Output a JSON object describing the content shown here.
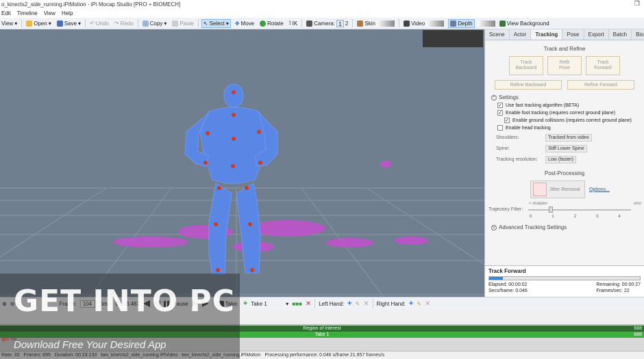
{
  "window": {
    "title": "o_kinects2_side_running.iPiMotion - iPi Mocap Studio [PRO + BIOMECH]",
    "restore_glyph": "❐"
  },
  "menu": [
    "Edit",
    "Timeline",
    "View",
    "Help"
  ],
  "toolbar": {
    "view": "View",
    "open": "Open",
    "save": "Save",
    "undo": "Undo",
    "redo": "Redo",
    "copy": "Copy",
    "paste": "Paste",
    "select": "Select",
    "move": "Move",
    "rotate": "Rotate",
    "ik": "IK",
    "camera": "Camera:",
    "cam1": "1",
    "cam2": "2",
    "skin": "Skin",
    "video": "Video",
    "depth": "Depth",
    "view_background": "View Background"
  },
  "panel": {
    "tabs": [
      "Scene",
      "Actor",
      "Tracking",
      "Pose",
      "Export",
      "Batch",
      "Biomech"
    ],
    "active_tab": "Tracking",
    "track_refine_title": "Track and Refine",
    "track_backward": "Track\nBackward",
    "refit_pose": "Refit\nPose",
    "track_forward": "Track\nForward",
    "refine_backward": "Refine Backward",
    "refine_forward": "Refine Forward",
    "settings_title": "Settings",
    "chk_fast": "Use fast tracking algorithm (BETA)",
    "chk_foot": "Enable foot tracking (requires correct ground plane)",
    "chk_ground": "Enable ground collisions (requires correct ground plane)",
    "chk_head": "Enable head tracking",
    "shoulders_label": "Shoulders:",
    "shoulders_value": "Tracked from video",
    "spine_label": "Spine:",
    "spine_value": "Stiff Lower Spine",
    "resolution_label": "Tracking resolution:",
    "resolution_value": "Low (faster)",
    "post_title": "Post-Processing",
    "jitter_label": "Jitter Removal",
    "options_link": "Options...",
    "sharpen_label": "< sharpen",
    "smooth_label": "smo",
    "filter_label": "Trajectory Filter:",
    "ticks": [
      "0",
      "1",
      "2",
      "3",
      "4"
    ],
    "advanced_title": "Advanced Tracking Settings"
  },
  "progress": {
    "title": "Track Forward",
    "elapsed_label": "Elapsed:",
    "elapsed": "00:00:02",
    "remaining_label": "Remaining:",
    "remaining": "00:00:27",
    "secs_label": "Secs/frame:",
    "secs": "0.046",
    "fps_label": "Frames/sec:",
    "fps": "22",
    "fraction": 0.09
  },
  "timeline": {
    "frame_label": "Frame:",
    "frame": "104",
    "time_label": "Time:",
    "time": "00:03.467",
    "pause_label": "Pause",
    "take_label": "Take:",
    "take_value": "Take 1",
    "left_hand": "Left Hand:",
    "right_hand": "Right Hand:"
  },
  "tracks": {
    "roi": "Region of Interest",
    "take": "Take 1",
    "end": "688",
    "row_label": "ight Ha",
    "row_label2": "ight Ha"
  },
  "status": [
    "Rate: 30",
    "Frames: 695",
    "Duration: 00:23.133",
    "two_kinects2_side_running.iPiVideo",
    "two_kinects2_side_running.iPiMotion",
    "Processing performance: 0.046 s/frame 21.957 frames/s"
  ],
  "watermark": {
    "main": "GET INTO PC",
    "sub": "Download Free Your Desired App"
  },
  "colors": {
    "skeleton": "#5a86e6",
    "joint": "#d23a1a",
    "points": "#d04ad8",
    "viewport_bg": "#6f7f8f"
  }
}
